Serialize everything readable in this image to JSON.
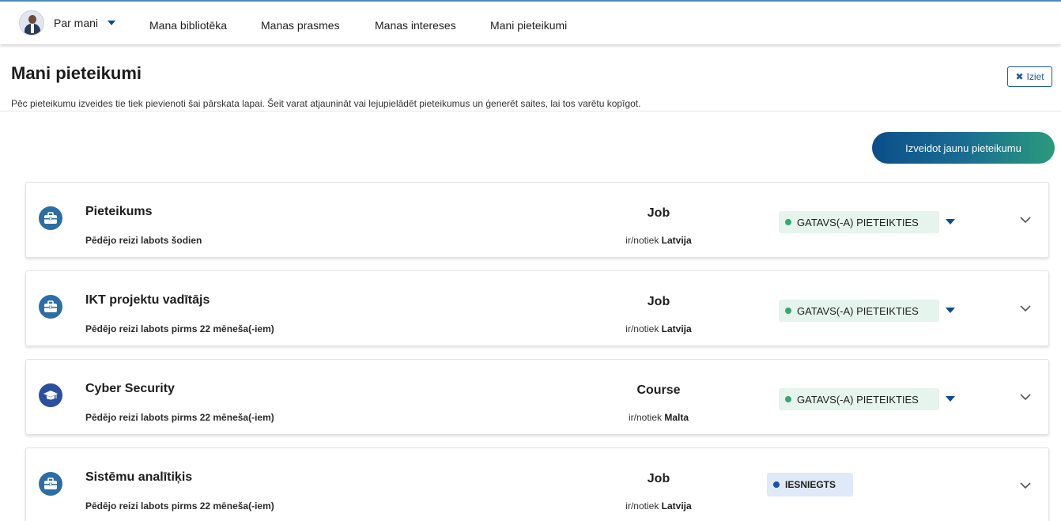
{
  "nav": {
    "profile_label": "Par mani",
    "items": [
      "Mana bibliotēka",
      "Manas prasmes",
      "Manas intereses",
      "Mani pieteikumi"
    ]
  },
  "page": {
    "title": "Mani pieteikumi",
    "exit_label": "Iziet",
    "description": "Pēc pieteikumu izveides tie tiek pievienoti šai pārskata lapai. Šeit varat atjaunināt vai lejupielādēt pieteikumus un ģenerēt saites, lai tos varētu kopīgot.",
    "create_button": "Izveidot jaunu pieteikumu"
  },
  "colors": {
    "accent": "#0c4a9a",
    "ready_bg": "#e5f4ec",
    "ready_dot": "#3aa570",
    "submitted_bg": "#dfe9f7",
    "submitted_dot": "#1f4fa6"
  },
  "applications": [
    {
      "title": "Pieteikums",
      "subtitle": "Pēdējo reizi labots šodien",
      "type": "Job",
      "location_prefix": "ir/notiek",
      "location": "Latvija",
      "status": "GATAVS(-A) PIETEIKTIES",
      "icon": "briefcase-icon"
    },
    {
      "title": "IKT projektu vadītājs",
      "subtitle": "Pēdējo reizi labots pirms 22 mēneša(-iem)",
      "type": "Job",
      "location_prefix": "ir/notiek",
      "location": "Latvija",
      "status": "GATAVS(-A) PIETEIKTIES",
      "icon": "briefcase-icon"
    },
    {
      "title": "Cyber Security",
      "subtitle": "Pēdējo reizi labots pirms 22 mēneša(-iem)",
      "type": "Course",
      "location_prefix": "ir/notiek",
      "location": "Malta",
      "status": "GATAVS(-A) PIETEIKTIES",
      "icon": "graduation-cap-icon"
    },
    {
      "title": "Sistēmu analītiķis",
      "subtitle": "Pēdējo reizi labots pirms 22 mēneša(-iem)",
      "type": "Job",
      "location_prefix": "ir/notiek",
      "location": "Latvija",
      "status": "IESNIEGTS",
      "icon": "briefcase-icon"
    }
  ]
}
